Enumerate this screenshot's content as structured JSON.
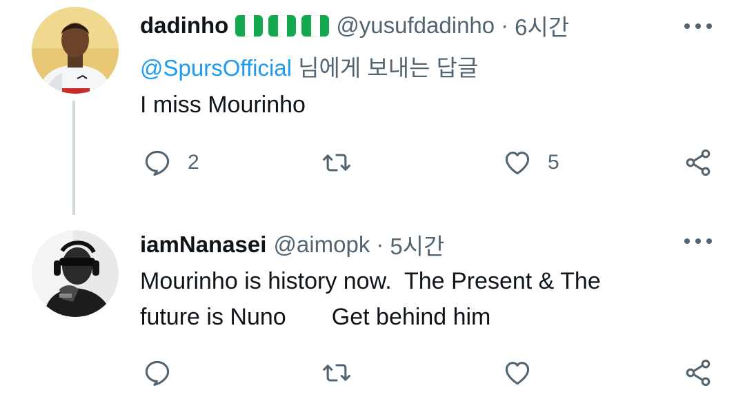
{
  "tweets": [
    {
      "display_name": "dadinho",
      "flags": [
        "nigeria-flag",
        "nigeria-flag",
        "nigeria-flag"
      ],
      "handle": "@yusufdadinho",
      "separator": "·",
      "time": "6시간",
      "reply_mention": "@SpursOfficial",
      "reply_suffix": " 님에게 보내는 답글",
      "text": "I miss Mourinho",
      "reply_count": "2",
      "retweet_count": "",
      "like_count": "5"
    },
    {
      "display_name": "iamNanasei",
      "handle": "@aimopk",
      "separator": "·",
      "time": "5시간",
      "text": "Mourinho is history now.  The Present & The\nfuture is Nuno       Get behind him",
      "reply_count": "",
      "retweet_count": "",
      "like_count": ""
    }
  ],
  "colors": {
    "text": "#0f1419",
    "secondary": "#536471",
    "link": "#1d9bf0",
    "thread_line": "#cfd9de",
    "flag_green": "#14a94f"
  },
  "icons": {
    "reply": "reply-icon",
    "retweet": "retweet-icon",
    "like": "heart-icon",
    "share": "share-icon",
    "more": "more-icon"
  }
}
